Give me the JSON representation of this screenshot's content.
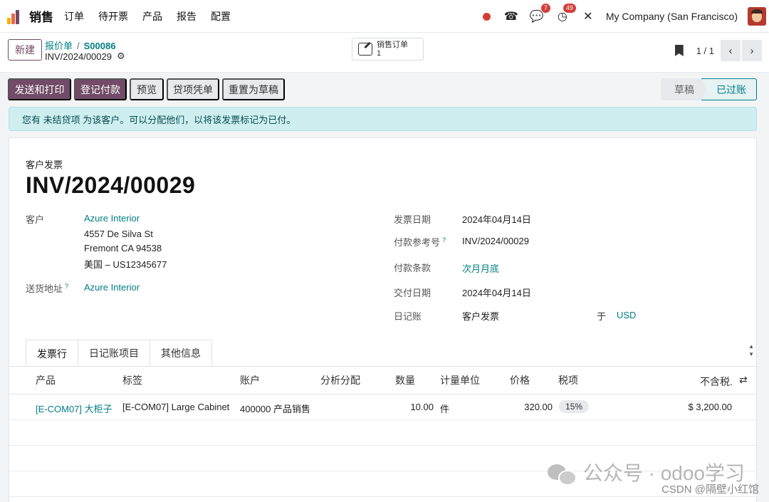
{
  "nav": {
    "app_name": "销售",
    "menu": [
      "订单",
      "待开票",
      "产品",
      "报告",
      "配置"
    ],
    "badges": {
      "chat": "7",
      "activity": "49"
    },
    "company": "My Company (San Francisco)",
    "brand_colors": [
      "#f4b400",
      "#e8684a",
      "#714B67"
    ]
  },
  "control": {
    "new_label": "新建",
    "breadcrumb_parent": "报价单",
    "breadcrumb_separator": "/",
    "breadcrumb_current": "S00086",
    "record_name": "INV/2024/00029",
    "smart_button": {
      "label": "销售订单",
      "count": "1"
    },
    "pager": "1 / 1"
  },
  "actions": {
    "send_print": "发送和打印",
    "register_payment": "登记付款",
    "preview": "预览",
    "credit_note": "贷项凭单",
    "reset_draft": "重置为草稿"
  },
  "statusbar": {
    "draft": "草稿",
    "posted": "已过账"
  },
  "alert": "您有 未结贷项 为该客户。可以分配他们，以将该发票标记为已付。",
  "form": {
    "doc_type": "客户发票",
    "doc_name": "INV/2024/00029",
    "customer_label": "客户",
    "customer_name": "Azure Interior",
    "address_line1": "4557 De Silva St",
    "address_line2": "Fremont CA 94538",
    "address_line3": "美国 – US12345677",
    "delivery_label": "送货地址",
    "delivery_value": "Azure Interior",
    "invoice_date_label": "发票日期",
    "invoice_date": "2024年04月14日",
    "payment_ref_label": "付款参考号",
    "payment_ref": "INV/2024/00029",
    "payment_terms_label": "付款条款",
    "payment_terms": "次月月底",
    "due_date_label": "交付日期",
    "due_date": "2024年04月14日",
    "journal_label": "日记账",
    "journal": "客户发票",
    "in_label": "于",
    "currency": "USD",
    "tooltip_mark": "?"
  },
  "tabs": [
    "发票行",
    "日记账项目",
    "其他信息"
  ],
  "lines": {
    "headers": {
      "product": "产品",
      "label": "标签",
      "account": "账户",
      "analytic": "分析分配",
      "quantity": "数量",
      "uom": "计量单位",
      "price": "价格",
      "taxes": "税项",
      "subtotal": "不含税."
    },
    "rows": [
      {
        "product": "[E-COM07] 大柜子",
        "label": "[E-COM07] Large Cabinet",
        "account": "400000 产品销售",
        "analytic": "",
        "quantity": "10.00",
        "uom": "件",
        "price": "320.00",
        "tax": "15%",
        "subtotal": "$ 3,200.00"
      }
    ]
  },
  "watermark": {
    "text": "公众号 · odoo学习",
    "source": "CSDN @隔壁小红馆"
  }
}
